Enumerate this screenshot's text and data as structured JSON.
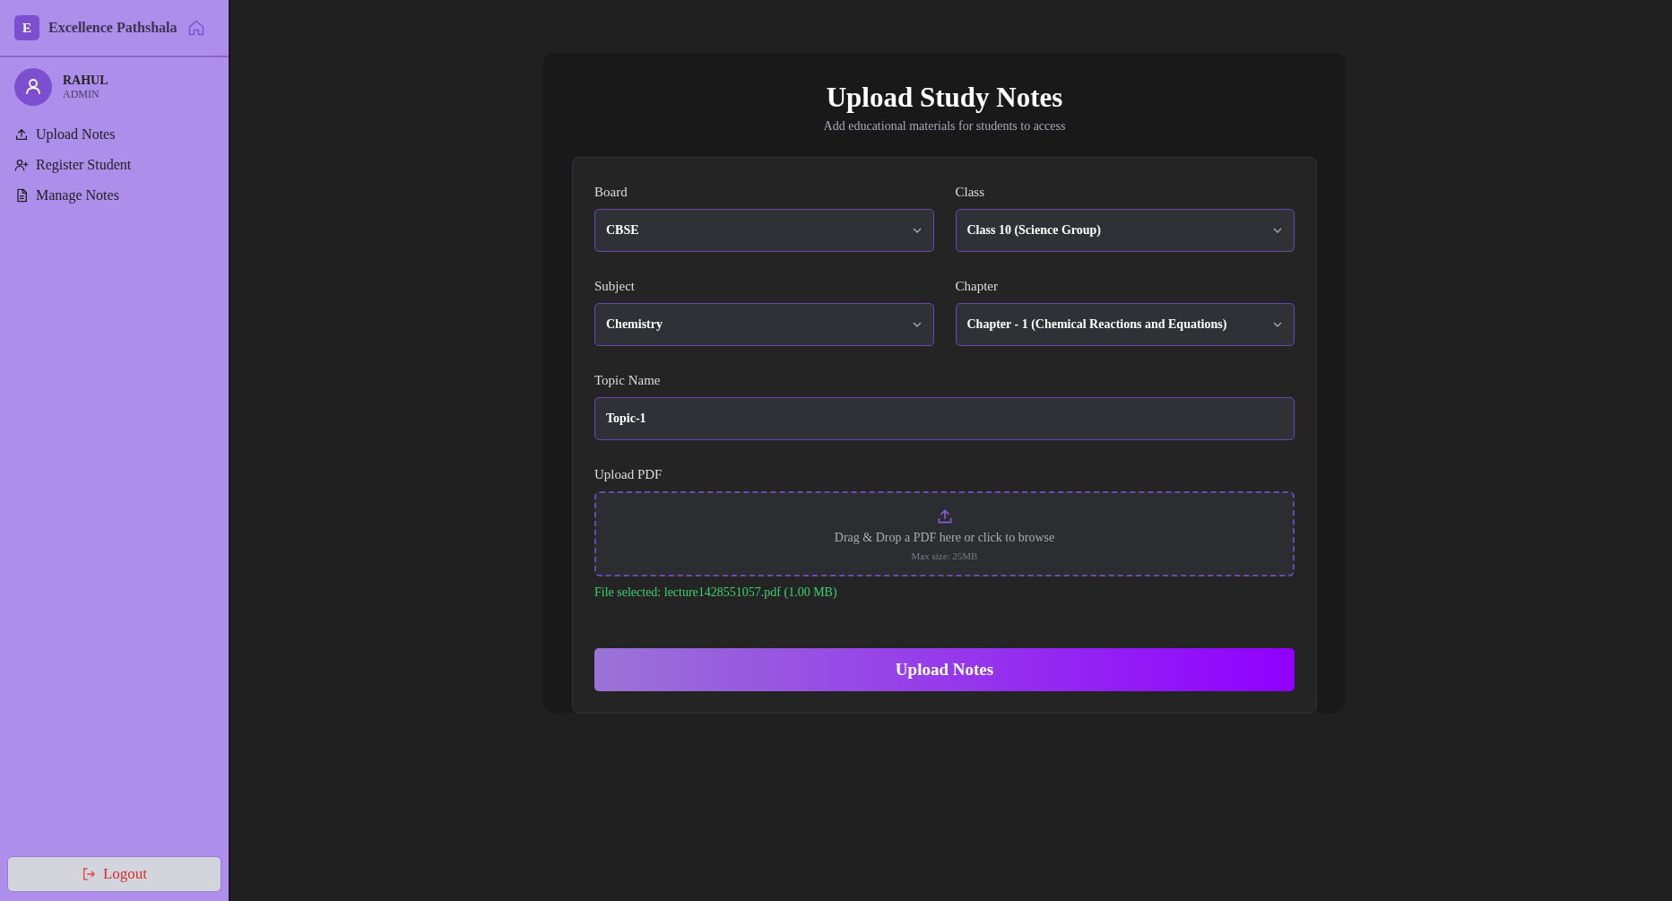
{
  "sidebar": {
    "brand": {
      "logo_letter": "E",
      "name": "Excellence Pathshala"
    },
    "user": {
      "name": "RAHUL",
      "role": "ADMIN"
    },
    "items": [
      {
        "label": "Upload Notes",
        "kind": "upload",
        "selected": false
      },
      {
        "label": "Register Student",
        "kind": "register",
        "selected": false
      },
      {
        "label": "Manage Notes",
        "kind": "manage",
        "selected": false
      }
    ],
    "logout": "Logout"
  },
  "form": {
    "title": "Upload Study Notes",
    "subtitle": "Add educational materials for students to access",
    "selects": [
      {
        "label": "Board",
        "value": "CBSE"
      },
      {
        "label": "Class",
        "value": "Class 10 (Science Group)"
      },
      {
        "label": "Subject",
        "value": "Chemistry"
      },
      {
        "label": "Chapter",
        "value": "Chapter - 1 (Chemical Reactions and Equations)"
      }
    ],
    "topic": {
      "label": "Topic Name",
      "value": "Topic-1"
    },
    "upload": {
      "label": "Upload PDF",
      "prompt": "Drag & Drop a PDF here or click to browse",
      "hint": "Max size: 25MB"
    },
    "file_status": "File selected: lecture1428551057.pdf (1.00 MB)",
    "submit": "Upload Notes"
  }
}
